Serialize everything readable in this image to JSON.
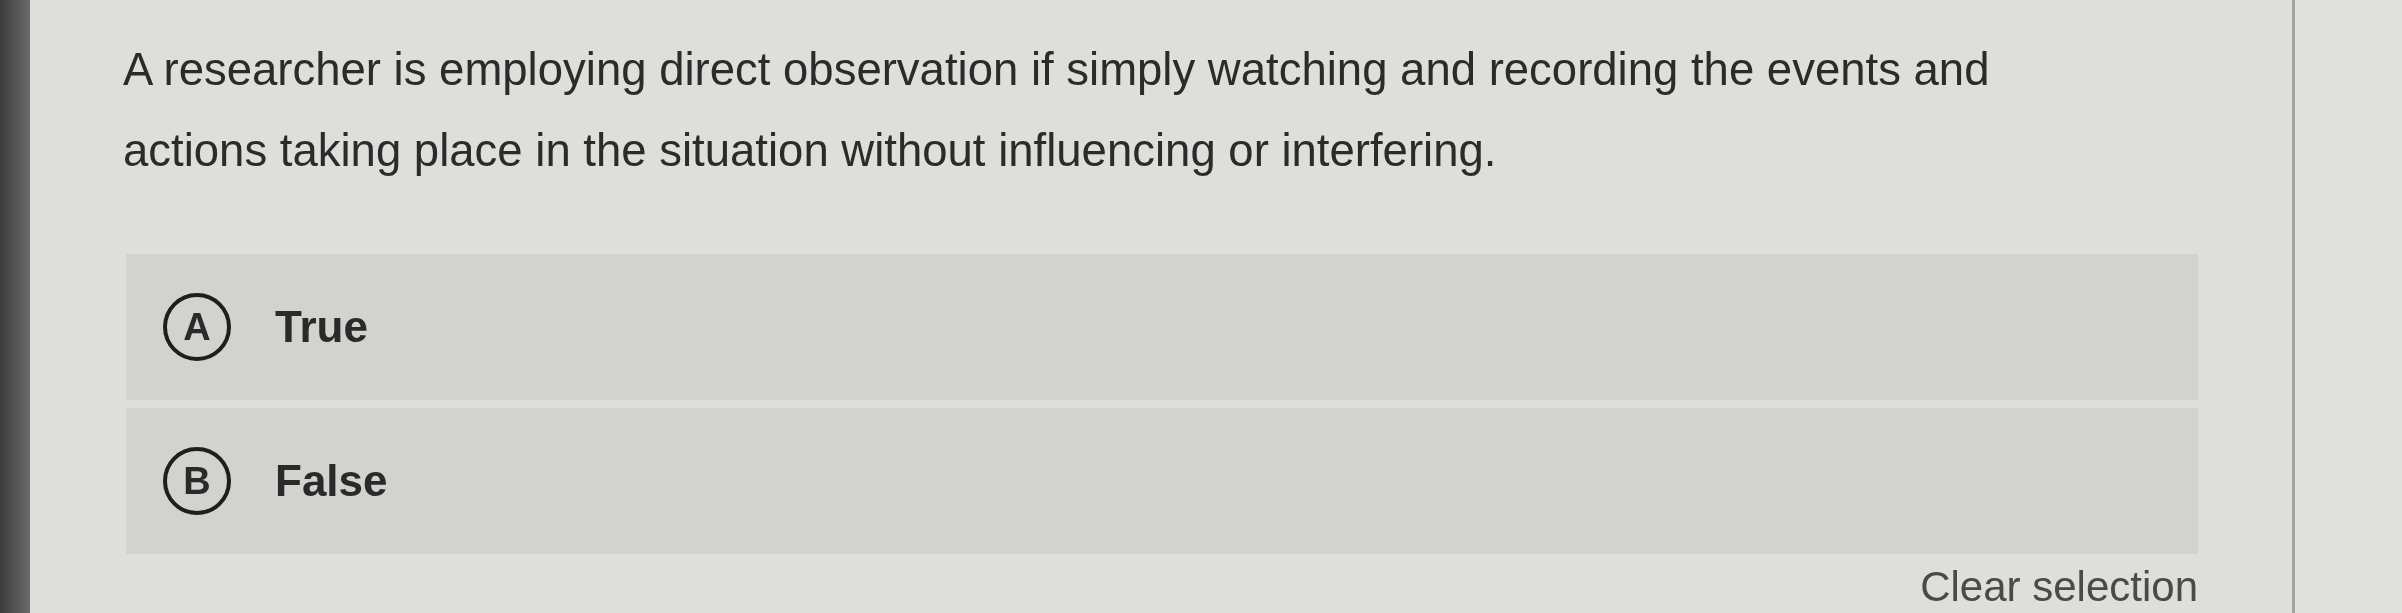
{
  "question": "A researcher is employing direct observation if simply watching and recording the events and actions taking place in the situation without influencing or interfering.",
  "options": [
    {
      "letter": "A",
      "label": "True",
      "selected": false
    },
    {
      "letter": "B",
      "label": "False",
      "selected": false
    }
  ],
  "clear_selection": "Clear selection"
}
